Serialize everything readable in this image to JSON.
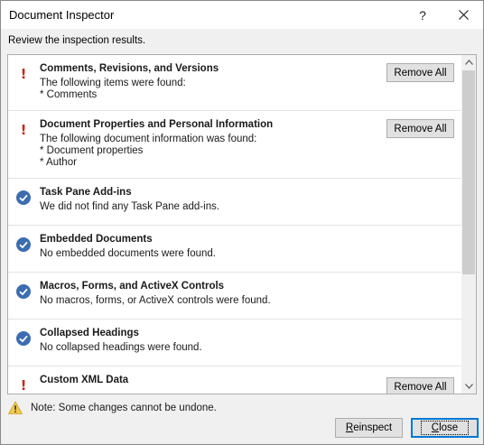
{
  "window": {
    "title": "Document Inspector",
    "help_label": "?",
    "subtitle": "Review the inspection results."
  },
  "items": [
    {
      "status": "warning",
      "heading": "Comments, Revisions, and Versions",
      "lines": [
        "The following items were found:",
        "* Comments"
      ],
      "button": "Remove All"
    },
    {
      "status": "warning",
      "heading": "Document Properties and Personal Information",
      "lines": [
        "The following document information was found:",
        "* Document properties",
        "* Author"
      ],
      "button": "Remove All"
    },
    {
      "status": "ok",
      "heading": "Task Pane Add-ins",
      "lines": [
        "We did not find any Task Pane add-ins."
      ]
    },
    {
      "status": "ok",
      "heading": "Embedded Documents",
      "lines": [
        "No embedded documents were found."
      ]
    },
    {
      "status": "ok",
      "heading": "Macros, Forms, and ActiveX Controls",
      "lines": [
        "No macros, forms, or ActiveX controls were found."
      ]
    },
    {
      "status": "ok",
      "heading": "Collapsed Headings",
      "lines": [
        "No collapsed headings were found."
      ]
    },
    {
      "status": "warning",
      "heading": "Custom XML Data",
      "lines": [],
      "button": "Remove All"
    }
  ],
  "footer": {
    "note": "Note: Some changes cannot be undone.",
    "reinspect_label": "Reinspect",
    "close_label": "Close"
  },
  "icons": {
    "warning_status": "exclamation-icon",
    "ok_status": "check-circle-icon",
    "note": "warning-triangle-icon"
  },
  "colors": {
    "warning": "#c42b1c",
    "ok": "#3c6db0",
    "accent": "#0078d7"
  }
}
